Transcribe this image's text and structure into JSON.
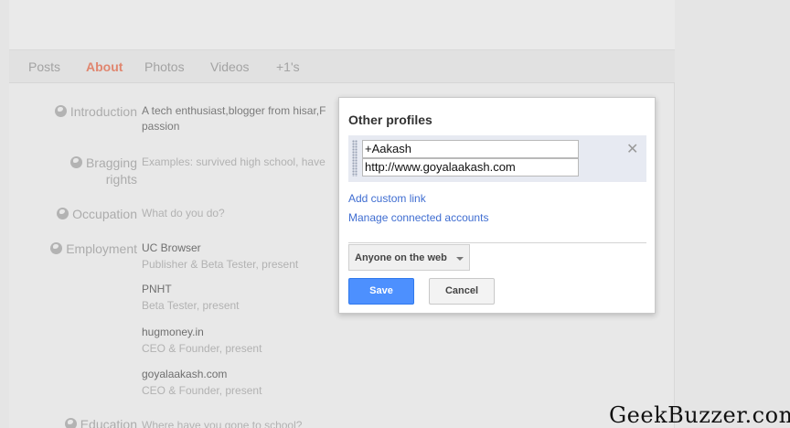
{
  "tabs": [
    {
      "label": "Posts",
      "active": false
    },
    {
      "label": "About",
      "active": true
    },
    {
      "label": "Photos",
      "active": false
    },
    {
      "label": "Videos",
      "active": false
    },
    {
      "label": "+1's",
      "active": false
    }
  ],
  "about": {
    "introduction": {
      "label": "Introduction",
      "text_line1": "A tech enthusiast,blogger from hisar,F",
      "text_line2": "passion"
    },
    "bragging": {
      "label_line1": "Bragging",
      "label_line2": "rights",
      "placeholder": "Examples: survived high school, have"
    },
    "occupation": {
      "label": "Occupation",
      "placeholder": "What do you do?"
    },
    "employment": {
      "label": "Employment",
      "jobs": [
        {
          "employer": "UC Browser",
          "role": "Publisher & Beta Tester, present"
        },
        {
          "employer": "PNHT",
          "role": "Beta Tester, present"
        },
        {
          "employer": "hugmoney.in",
          "role": "CEO & Founder, present"
        },
        {
          "employer": "goyalaakash.com",
          "role": "CEO & Founder, present"
        }
      ]
    },
    "education": {
      "label": "Education",
      "placeholder": "Where have you gone to school?"
    }
  },
  "dialog": {
    "title": "Other profiles",
    "profile_label_value": "+Aakash",
    "profile_url_value": "http://www.goyalaakash.com",
    "remove_symbol": "✕",
    "add_custom_link": "Add custom link",
    "manage_accounts": "Manage connected accounts",
    "visibility": "Anyone on the web",
    "save_label": "Save",
    "cancel_label": "Cancel"
  },
  "watermark": "GeekBuzzer.com",
  "colors": {
    "accent_tab": "#e0866f",
    "link": "#3f6dd1",
    "save_button": "#4d90fe"
  }
}
